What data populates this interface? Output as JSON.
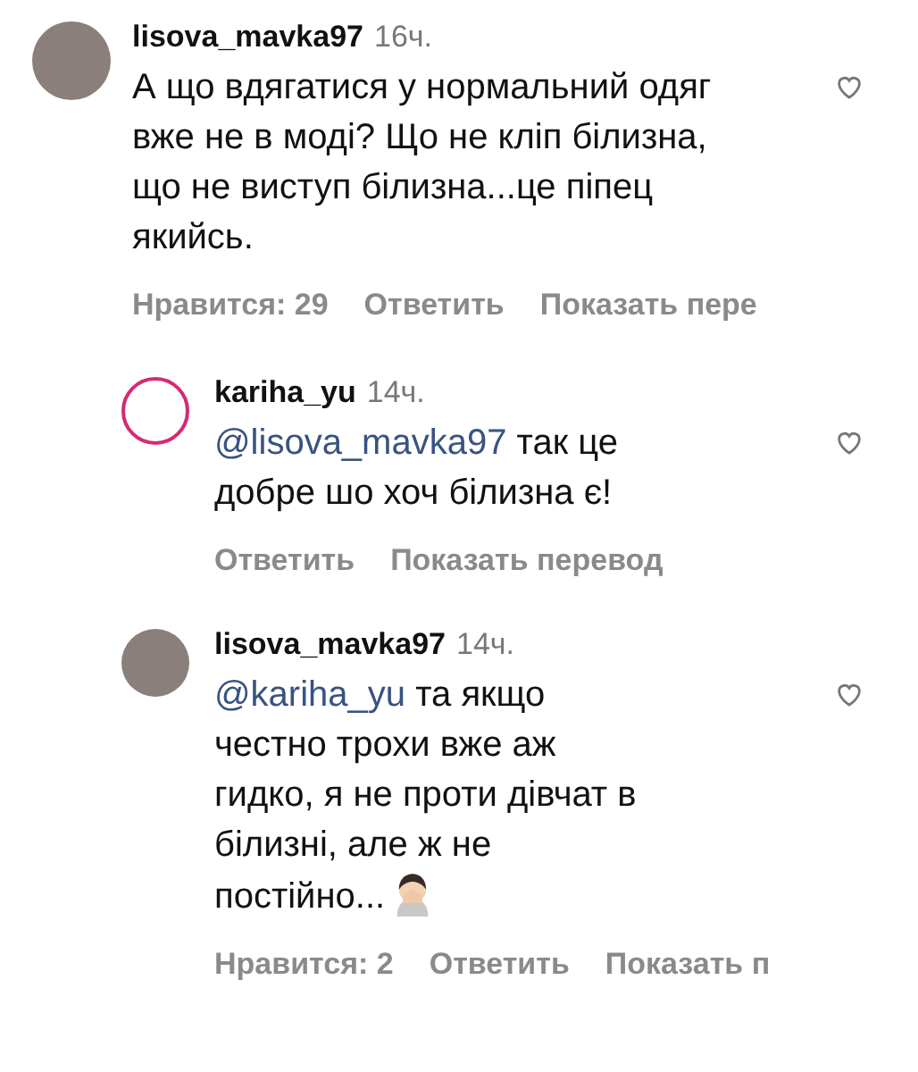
{
  "comments": [
    {
      "author": "lisova_mavka97",
      "time": "16ч.",
      "text": "А що вдягатися у нормальний одяг вже не в моді? Що не кліп білизна, що не виступ білизна...це піпец якийсь.",
      "likes": "Нравится: 29",
      "reply": "Ответить",
      "translate": "Показать пере",
      "children": [
        {
          "author": "kariha_yu",
          "time": "14ч.",
          "mention": "@lisova_mavka97",
          "text": "так це добре шо хоч білизна є!",
          "reply": "Ответить",
          "translate": "Показать перевод",
          "story_ring": true
        },
        {
          "author": "lisova_mavka97",
          "time": "14ч.",
          "mention": "@kariha_yu",
          "text": "та якщо честно трохи вже аж гидко, я не проти дівчат в білизні, але ж не постійно...",
          "emoji": true,
          "likes": "Нравится: 2",
          "reply": "Ответить",
          "translate": "Показать п",
          "story_ring": false
        }
      ]
    }
  ]
}
